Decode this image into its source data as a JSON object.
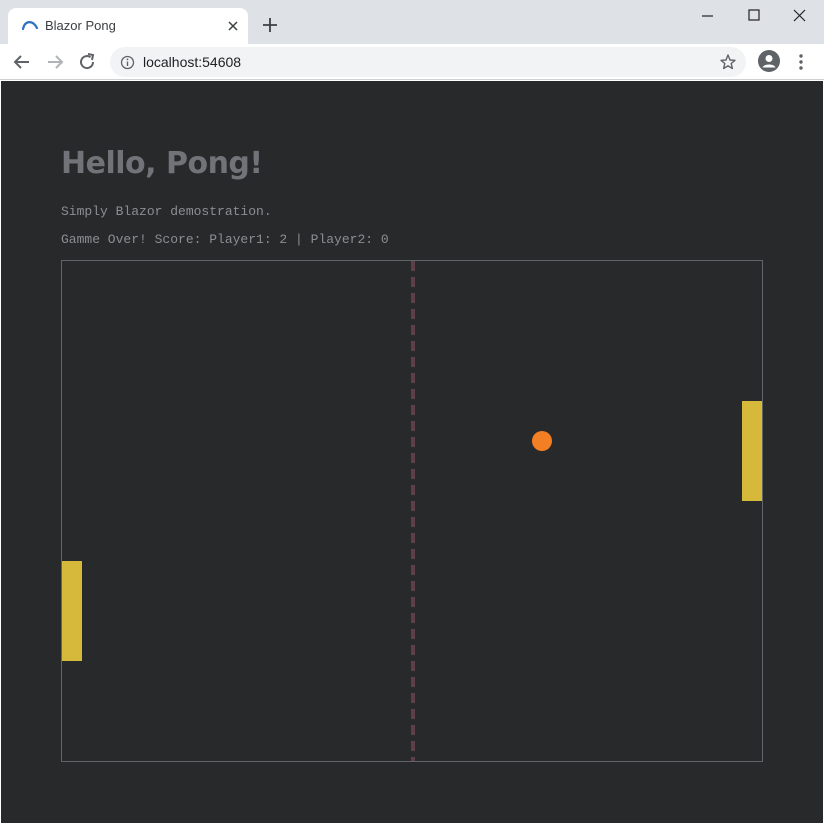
{
  "browser": {
    "tab_title": "Blazor Pong",
    "url": "localhost:54608",
    "icons": {
      "favicon": "blazor-icon",
      "tab_close": "close-icon",
      "new_tab": "plus-icon",
      "minimize": "minimize-icon",
      "maximize": "maximize-icon",
      "close": "close-icon",
      "back": "back-arrow-icon",
      "forward": "forward-arrow-icon",
      "reload": "reload-icon",
      "site_info": "info-icon",
      "bookmark": "star-icon",
      "profile": "profile-icon",
      "menu": "kebab-menu-icon"
    }
  },
  "page": {
    "heading": "Hello, Pong!",
    "subtitle": "Simply Blazor demostration.",
    "status": "Gamme Over! Score: Player1: 2 | Player2: 0"
  },
  "game": {
    "colors": {
      "background": "#28292b",
      "paddle": "#d6b93b",
      "ball": "#f37f24",
      "net": "#5d3f47",
      "border": "#616468"
    }
  }
}
